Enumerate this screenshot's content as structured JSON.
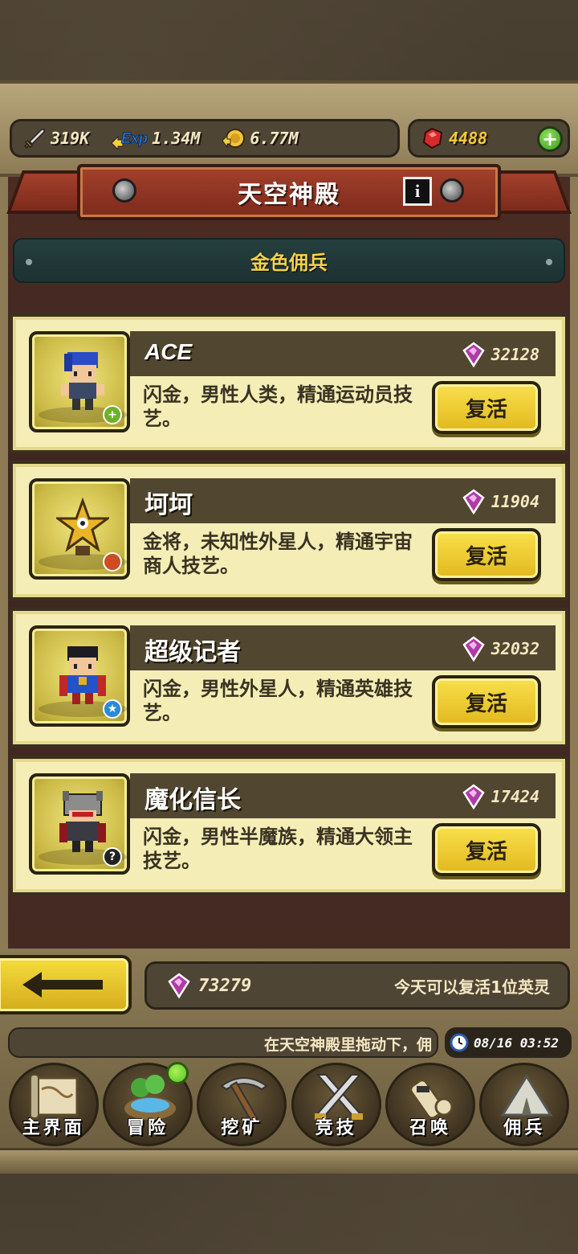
{
  "resources": {
    "attack": {
      "icon": "sword-icon",
      "value": "319K"
    },
    "exp": {
      "icon": "exp-icon",
      "label": "Exp",
      "value": "1.34M"
    },
    "gold": {
      "icon": "gold-coin-icon",
      "value": "6.77M"
    },
    "gems": {
      "icon": "red-gem-icon",
      "value": "4488"
    }
  },
  "header": {
    "title": "天空神殿",
    "info_label": "i",
    "subtitle": "金色佣兵"
  },
  "heroes": [
    {
      "name": "ACE",
      "price": "32128",
      "desc": "闪金，男性人类，精通运动员技艺。",
      "button": "复活",
      "badge": "plus-badge-icon",
      "badge_text": "+"
    },
    {
      "name": "坷坷",
      "price": "11904",
      "desc": "金将，未知性外星人，精通宇宙商人技艺。",
      "button": "复活",
      "badge": "key-badge-icon",
      "badge_text": ""
    },
    {
      "name": "超级记者",
      "price": "32032",
      "desc": "闪金，男性外星人，精通英雄技艺。",
      "button": "复活",
      "badge": "star-badge-icon",
      "badge_text": "★"
    },
    {
      "name": "魔化信长",
      "price": "17424",
      "desc": "闪金，男性半魔族，精通大领主技艺。",
      "button": "复活",
      "badge": "question-badge-icon",
      "badge_text": "?"
    }
  ],
  "footer": {
    "soul_total": "73279",
    "revive_message": "今天可以复活1位英灵",
    "ticker": "在天空神殿里拖动下，佣",
    "datetime": "08/16 03:52"
  },
  "nav": [
    {
      "label": "主界面",
      "icon": "map-scroll-icon"
    },
    {
      "label": "冒险",
      "icon": "island-icon",
      "notification": true
    },
    {
      "label": "挖矿",
      "icon": "pickaxe-icon"
    },
    {
      "label": "竞技",
      "icon": "crossed-swords-icon"
    },
    {
      "label": "召唤",
      "icon": "summon-scroll-icon"
    },
    {
      "label": "佣兵",
      "icon": "tent-icon"
    }
  ],
  "colors": {
    "accent_gold": "#f6d24a",
    "banner_red": "#a3402c",
    "card_bg": "#f4eeb6",
    "button_yellow": "#f9e04c",
    "soul_gem_purple": "#b03aa8"
  }
}
